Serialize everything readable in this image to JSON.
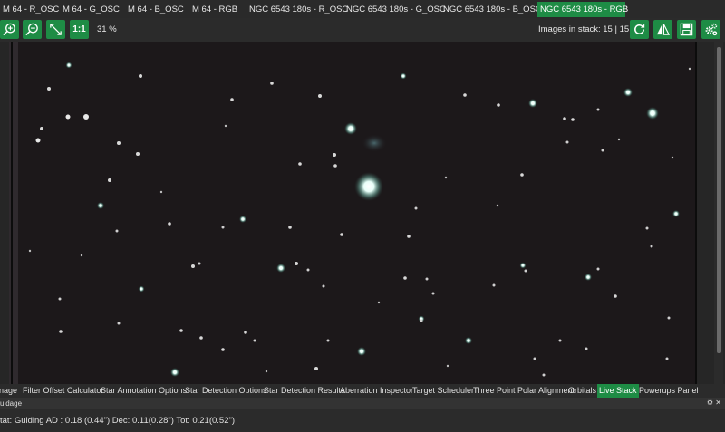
{
  "tabs": [
    {
      "label": "M 64 - R_OSC",
      "active": false
    },
    {
      "label": "M 64 - G_OSC",
      "active": false
    },
    {
      "label": "M 64 - B_OSC",
      "active": false
    },
    {
      "label": "M 64 - RGB",
      "active": false
    },
    {
      "label": "NGC 6543 180s - R_OSC",
      "active": false
    },
    {
      "label": "NGC 6543 180s - G_OSC",
      "active": false
    },
    {
      "label": "NGC 6543 180s - B_OSC",
      "active": false
    },
    {
      "label": "NGC 6543 180s - RGB",
      "active": true
    }
  ],
  "toolbar": {
    "zoom_in_icon": "zoom-in-icon",
    "zoom_out_icon": "zoom-out-icon",
    "fit_icon": "fit-to-screen-icon",
    "one_to_one_label": "1:1",
    "zoom_level": "31 %",
    "images_in_stack": "Images in stack: 15 | 15 | 15",
    "refresh_icon": "refresh-icon",
    "flip_icon": "mirror-flip-icon",
    "save_icon": "save-icon",
    "settings_icon": "settings-gears-icon"
  },
  "bottom_tabs": [
    {
      "label": "nage",
      "active": false
    },
    {
      "label": "Filter Offset Calculator",
      "active": false
    },
    {
      "label": "Star Annotation Options",
      "active": false
    },
    {
      "label": "Star Detection Options",
      "active": false
    },
    {
      "label": "Star Detection Results",
      "active": false
    },
    {
      "label": "Aberration Inspector",
      "active": false
    },
    {
      "label": "Target Scheduler",
      "active": false
    },
    {
      "label": "Three Point Polar Alignment",
      "active": false
    },
    {
      "label": "Orbitals",
      "active": false
    },
    {
      "label": "Live Stack",
      "active": true
    },
    {
      "label": "Powerups Panel",
      "active": false
    }
  ],
  "guide_panel": {
    "title": "uidage",
    "status": "tat: Guiding  AD : 0.18 (0.44\")  Dec: 0.11(0.28\")  Tot: 0.21(0.52\")"
  },
  "colors": {
    "accent": "#1e8c45",
    "background": "#2b2b2b",
    "sky": "#1c181a"
  }
}
